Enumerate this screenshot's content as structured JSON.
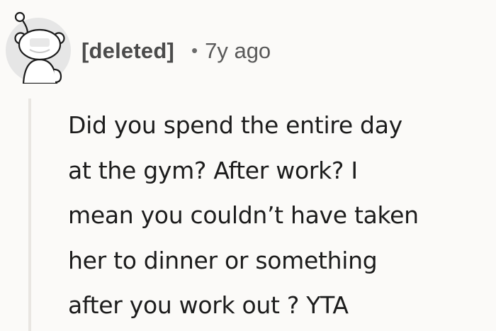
{
  "comment": {
    "author": "[deleted]",
    "separator": "•",
    "age": "7y ago",
    "avatar_icon": "snoo-avatar-icon",
    "body": "Did you spend the entire day\nat the gym? After work? I\nmean you couldn’t have taken\nher to dinner or something\nafter you work out ? YTA"
  },
  "colors": {
    "background": "#fbfaf8",
    "text": "#1c1c1c",
    "author": "#4b4b4b",
    "muted": "#595959",
    "thread_line": "#e9e6e2"
  }
}
